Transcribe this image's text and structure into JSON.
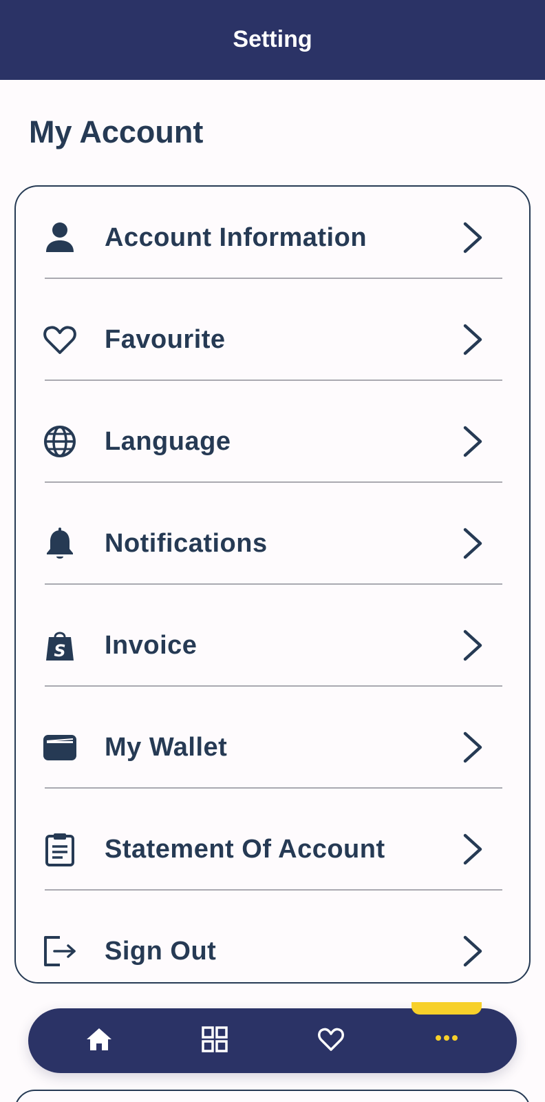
{
  "app_bar": {
    "title": "Setting"
  },
  "section": {
    "title": "My Account"
  },
  "menu": {
    "items": [
      {
        "label": "Account Information",
        "icon": "person-icon"
      },
      {
        "label": "Favourite",
        "icon": "heart-icon"
      },
      {
        "label": "Language",
        "icon": "globe-icon"
      },
      {
        "label": "Notifications",
        "icon": "bell-icon"
      },
      {
        "label": "Invoice",
        "icon": "shopping-bag-icon"
      },
      {
        "label": "My Wallet",
        "icon": "wallet-icon"
      },
      {
        "label": "Statement Of Account",
        "icon": "clipboard-icon"
      },
      {
        "label": "Sign Out",
        "icon": "sign-out-icon"
      }
    ]
  },
  "bottom_nav": {
    "items": [
      {
        "icon": "home-icon",
        "active": false
      },
      {
        "icon": "grid-icon",
        "active": false
      },
      {
        "icon": "heart-outline-icon",
        "active": false
      },
      {
        "icon": "more-dots-icon",
        "active": true
      }
    ]
  },
  "colors": {
    "primary": "#2b3366",
    "text": "#263a54",
    "accent": "#f7d02a",
    "background": "#fefbfd",
    "divider": "#a9a9b0"
  }
}
